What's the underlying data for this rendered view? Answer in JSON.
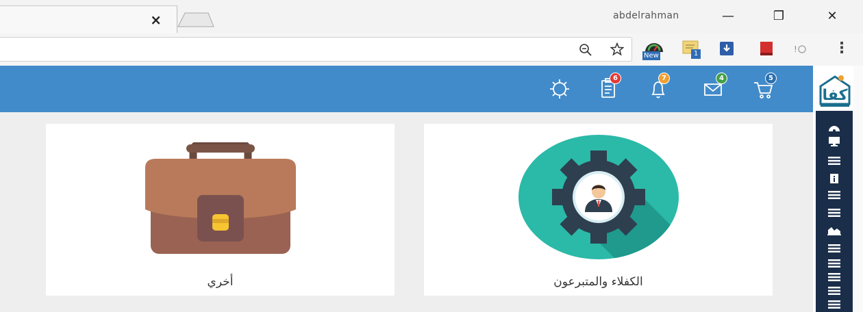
{
  "browser": {
    "user_name": "abdelrahman",
    "tab_close": "×",
    "extensions": {
      "new_badge": "New",
      "count_badge": "1"
    },
    "window_controls": {
      "minimize": "—",
      "restore": "❐",
      "close": "✕"
    },
    "menu": "⋮"
  },
  "header": {
    "icons": [
      {
        "name": "settings",
        "badge": null
      },
      {
        "name": "notes",
        "badge": "6",
        "badge_color": "#e53935"
      },
      {
        "name": "bell",
        "badge": "7",
        "badge_color": "#f0a030"
      },
      {
        "name": "mail",
        "badge": "4",
        "badge_color": "#43a047"
      },
      {
        "name": "cart",
        "badge": "5",
        "badge_color": "#2a6fb0"
      }
    ],
    "color": "#428bca"
  },
  "cards": [
    {
      "label": "أخري",
      "icon": "briefcase-icon"
    },
    {
      "label": "الكفلاء والمتبرعون",
      "icon": "sponsors-gear-icon"
    }
  ],
  "sidebar": {
    "items": [
      "dashboard",
      "monitor",
      "list",
      "info",
      "list",
      "list",
      "chart",
      "list",
      "list",
      "list",
      "list",
      "list"
    ]
  }
}
